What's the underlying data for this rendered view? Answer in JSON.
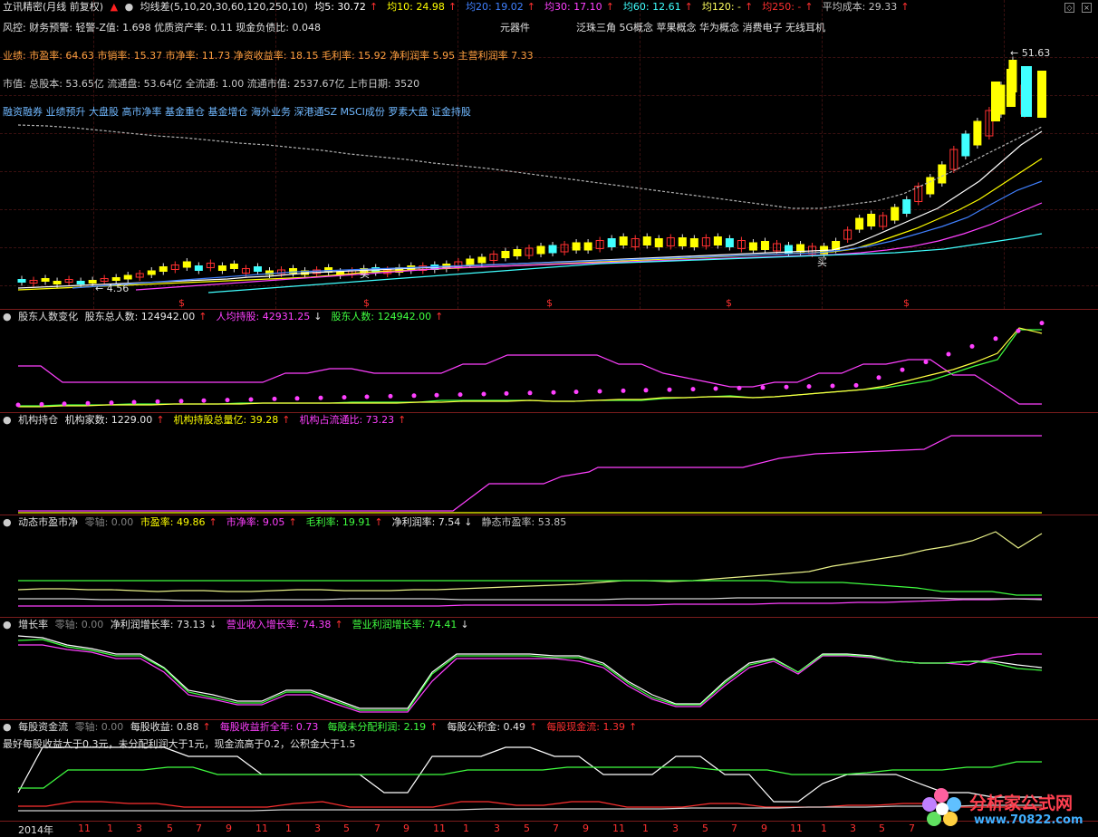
{
  "colors": {
    "bg": "#000000",
    "grid": "#7a1c1c",
    "white": "#e8e8e8",
    "yellow": "#ffff00",
    "magenta": "#ff40ff",
    "green": "#40ff40",
    "cyan": "#40ffff",
    "red": "#ff3030",
    "orange": "#ffa060",
    "blue": "#4080ff"
  },
  "main": {
    "title": "立讯精密(月线 前复权)",
    "ma_label": "均线差(5,10,20,30,60,120,250,10)",
    "ma": [
      {
        "label": "均5: 30.72",
        "arrow": "↑",
        "color": "#ffffff"
      },
      {
        "label": "均10: 24.98",
        "arrow": "↑",
        "color": "#ffff00"
      },
      {
        "label": "均20: 19.02",
        "arrow": "↑",
        "color": "#4080ff"
      },
      {
        "label": "均30: 17.10",
        "arrow": "↑",
        "color": "#ff40ff"
      },
      {
        "label": "均60: 12.61",
        "arrow": "↑",
        "color": "#40ffff"
      },
      {
        "label": "均120: -",
        "arrow": "↑",
        "color": "#ffff60"
      },
      {
        "label": "均250: -",
        "arrow": "↑",
        "color": "#ff3030"
      },
      {
        "label": "平均成本: 29.33",
        "arrow": "↑",
        "color": "#c0c0c0"
      }
    ],
    "risk": "风控: 财务预警: 轻警-Z值: 1.698 优质资产率: 0.11 现金负债比: 0.048",
    "industry": "元器件",
    "concepts": "泛珠三角 5G概念 苹果概念 华为概念 消费电子 无线耳机",
    "perf": "业绩: 市盈率: 64.63 市销率: 15.37 市净率: 11.73 净资收益率: 18.15 毛利率: 15.92 净利润率 5.95 主营利润率 7.33",
    "cap": "市值: 总股本: 53.65亿 流通盘: 53.64亿 全流通: 1.00 流通市值: 2537.67亿 上市日期: 3520",
    "tags": "融资融券 业绩预升 大盘股 高市净率 基金重仓 基金增仓 海外业务 深港通SZ MSCI成份 罗素大盘 证金持股",
    "high_label": "← 51.63",
    "low_label": "← 4.56",
    "buy_label": "买",
    "s_label": "$"
  },
  "holders": {
    "title": "股东人数变化",
    "items": [
      {
        "label": "股东总人数: 124942.00",
        "arrow": "↑",
        "color": "#e8e8e8"
      },
      {
        "label": "人均持股: 42931.25",
        "arrow": "↓",
        "color": "#ff40ff"
      },
      {
        "label": "股东人数: 124942.00",
        "arrow": "↑",
        "color": "#40ff40"
      }
    ]
  },
  "inst": {
    "title": "机构持仓",
    "items": [
      {
        "label": "机构家数: 1229.00",
        "arrow": "↑",
        "color": "#e8e8e8"
      },
      {
        "label": "机构持股总量亿: 39.28",
        "arrow": "↑",
        "color": "#ffff00"
      },
      {
        "label": "机构占流通比: 73.23",
        "arrow": "↑",
        "color": "#ff40ff"
      }
    ]
  },
  "pe": {
    "title": "动态市盈市净",
    "zero": "零轴: 0.00",
    "items": [
      {
        "label": "市盈率: 49.86",
        "arrow": "↑",
        "color": "#ffff00"
      },
      {
        "label": "市净率: 9.05",
        "arrow": "↑",
        "color": "#ff40ff"
      },
      {
        "label": "毛利率: 19.91",
        "arrow": "↑",
        "color": "#40ff40"
      },
      {
        "label": "净利润率: 7.54",
        "arrow": "↓",
        "color": "#e8e8e8"
      },
      {
        "label": "静态市盈率: 53.85",
        "arrow": "",
        "color": "#c0c0c0"
      }
    ]
  },
  "growth": {
    "title": "增长率",
    "zero": "零轴: 0.00",
    "items": [
      {
        "label": "净利润增长率: 73.13",
        "arrow": "↓",
        "color": "#e8e8e8"
      },
      {
        "label": "营业收入增长率: 74.38",
        "arrow": "↑",
        "color": "#ff40ff"
      },
      {
        "label": "营业利润增长率: 74.41",
        "arrow": "↓",
        "color": "#40ff40"
      }
    ]
  },
  "pershare": {
    "title": "每股资金流",
    "zero": "零轴: 0.00",
    "items": [
      {
        "label": "每股收益: 0.88",
        "arrow": "↑",
        "color": "#e8e8e8"
      },
      {
        "label": "每股收益折全年: 0.73",
        "arrow": "",
        "color": "#ff40ff"
      },
      {
        "label": "每股未分配利润: 2.19",
        "arrow": "↑",
        "color": "#40ff40"
      },
      {
        "label": "每股公积金: 0.49",
        "arrow": "↑",
        "color": "#e8e8e8"
      },
      {
        "label": "每股现金流: 1.39",
        "arrow": "↑",
        "color": "#ff3030"
      }
    ],
    "note": "最好每股收益大于0.3元，未分配利润大于1元，现金流高于0.2，公积金大于1.5"
  },
  "axis": {
    "labels": [
      "2014年",
      "11",
      "1",
      "3",
      "5",
      "7",
      "9",
      "11",
      "1",
      "3",
      "5",
      "7",
      "9",
      "11",
      "1",
      "3",
      "5",
      "7",
      "9",
      "11",
      "1",
      "3",
      "5",
      "7",
      "9",
      "11",
      "1",
      "3",
      "5",
      "7"
    ]
  },
  "logo": {
    "text": "分析家公式网",
    "url": "www.70822.com"
  }
}
